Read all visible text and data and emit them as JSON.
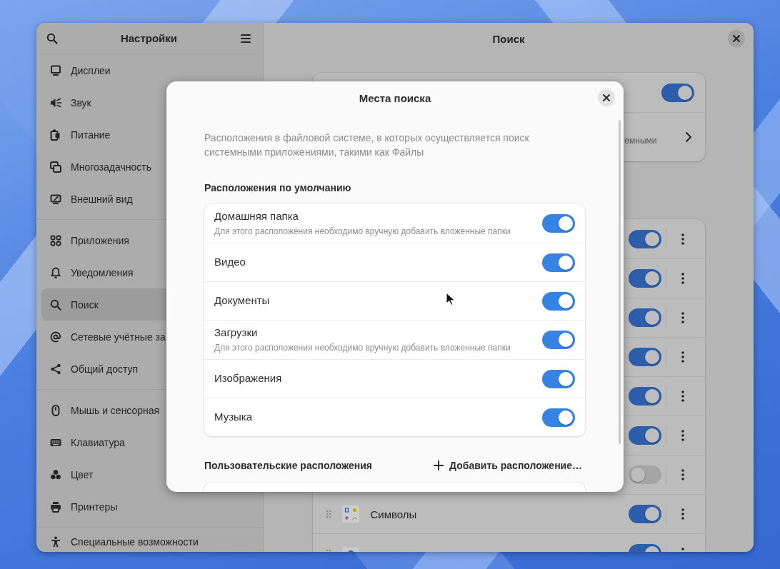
{
  "settings_window": {
    "sidebar": {
      "title": "Настройки",
      "groups": [
        {
          "items": [
            {
              "label": "Дисплеи",
              "selected": false
            },
            {
              "label": "Звук",
              "selected": false
            },
            {
              "label": "Питание",
              "selected": false
            },
            {
              "label": "Многозадачность",
              "selected": false
            },
            {
              "label": "Внешний вид",
              "selected": false
            }
          ]
        },
        {
          "items": [
            {
              "label": "Приложения",
              "selected": false
            },
            {
              "label": "Уведомления",
              "selected": false
            },
            {
              "label": "Поиск",
              "selected": true
            },
            {
              "label": "Сетевые учётные за",
              "selected": false
            },
            {
              "label": "Общий доступ",
              "selected": false
            }
          ]
        },
        {
          "items": [
            {
              "label": "Мышь и сенсорная",
              "selected": false
            },
            {
              "label": "Клавиатура",
              "selected": false
            },
            {
              "label": "Цвет",
              "selected": false
            },
            {
              "label": "Принтеры",
              "selected": false
            }
          ]
        },
        {
          "items": [
            {
              "label": "Специальные возможности",
              "selected": false
            }
          ]
        }
      ]
    },
    "page": {
      "title": "Поиск",
      "search_card": {
        "rows": [
          {
            "kind": "switch",
            "on": true
          },
          {
            "kind": "link",
            "subtitle": "емными"
          }
        ]
      },
      "apps_card": {
        "rows": [
          {
            "on": true
          },
          {
            "on": true
          },
          {
            "on": true
          },
          {
            "on": true
          },
          {
            "on": true
          },
          {
            "on": true
          },
          {
            "on": false
          },
          {
            "name": "Символы",
            "on": true
          },
          {
            "on": true
          }
        ]
      }
    }
  },
  "search_locations_dialog": {
    "title": "Места поиска",
    "description": "Расположения в файловой системе, в которых осуществляется поиск системными приложениями, такими как Файлы",
    "default_section": {
      "heading": "Расположения по умолчанию",
      "rows": [
        {
          "name": "Домашняя папка",
          "subtitle": "Для этого расположения необходимо вручную добавить вложенные папки",
          "on": true
        },
        {
          "name": "Видео",
          "on": true
        },
        {
          "name": "Документы",
          "on": true
        },
        {
          "name": "Загрузки",
          "subtitle": "Для этого расположения необходимо вручную добавить вложенные папки",
          "on": true
        },
        {
          "name": "Изображения",
          "on": true
        },
        {
          "name": "Музыка",
          "on": true
        }
      ]
    },
    "custom_section": {
      "heading": "Пользовательские расположения",
      "add_button": "Добавить расположение…"
    }
  }
}
